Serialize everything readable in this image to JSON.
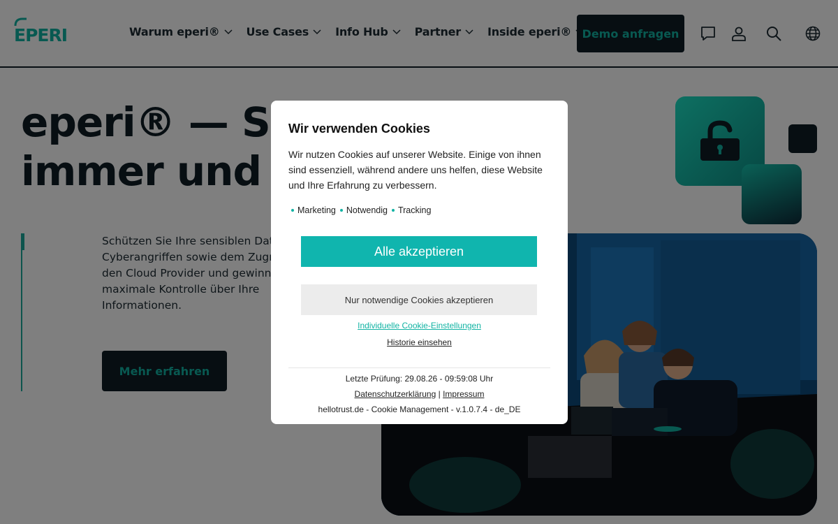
{
  "brand": {
    "logo_text": "EPERI",
    "accent": "#11b3a3",
    "dark": "#0f1c24"
  },
  "nav": {
    "items": [
      {
        "label": "Warum eperi®"
      },
      {
        "label": "Use Cases"
      },
      {
        "label": "Info Hub"
      },
      {
        "label": "Partner"
      },
      {
        "label": "Inside eperi®"
      }
    ],
    "demo_label": "Demo anfragen",
    "icons": [
      "chat-icon",
      "user-icon",
      "search-icon",
      "globe-icon"
    ]
  },
  "hero": {
    "title_line1": "eperi® — Sich",
    "title_line2": "immer und üb",
    "text_lines": [
      "Schützen Sie Ihre sensiblen Daten",
      "Cyberangriffen sowie dem Zugriff",
      "den Cloud Provider und gewinne",
      "maximale Kontrolle über Ihre",
      "Informationen."
    ],
    "cta_label": "Mehr erfahren"
  },
  "cookie": {
    "title": "Wir verwenden Cookies",
    "description": "Wir nutzen Cookies auf unserer Website. Einige von ihnen sind essenziell, während andere uns helfen, diese Website und Ihre Erfahrung zu verbessern.",
    "categories": [
      "Marketing",
      "Notwendig",
      "Tracking"
    ],
    "accept_all_label": "Alle akzeptieren",
    "accept_necessary_label": "Nur notwendige Cookies akzeptieren",
    "individual_label": "Individuelle Cookie-Einstellungen",
    "history_label": "Historie einsehen",
    "last_check": "Letzte Prüfung: 29.08.26 - 09:59:08 Uhr",
    "privacy_label": "Datenschutzerklärung",
    "separator": "|",
    "imprint_label": "Impressum",
    "version": "hellotrust.de - Cookie Management - v.1.0.7.4 - de_DE"
  }
}
